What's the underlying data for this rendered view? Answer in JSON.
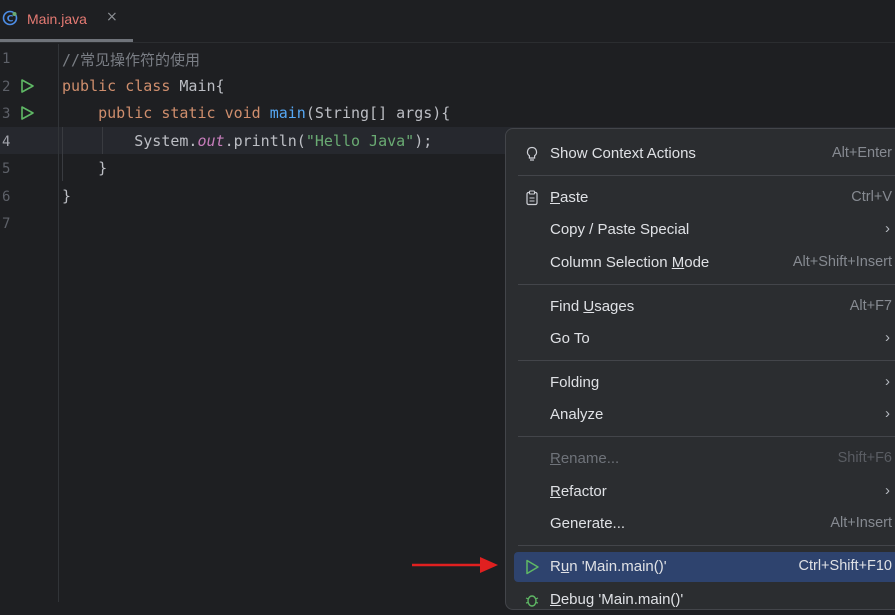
{
  "tab": {
    "filename": "Main.java",
    "close_glyph": "×",
    "icon": "java-class-icon"
  },
  "editor": {
    "line_numbers": [
      "1",
      "2",
      "3",
      "4",
      "5",
      "6",
      "7"
    ],
    "lines": [
      {
        "parts": [
          {
            "t": "//常见操作符的使用",
            "c": "cm"
          }
        ]
      },
      {
        "parts": [
          {
            "t": "public",
            "c": "kw"
          },
          {
            "t": " "
          },
          {
            "t": "class",
            "c": "kw"
          },
          {
            "t": " Main{"
          }
        ]
      },
      {
        "parts": [
          {
            "t": "    "
          },
          {
            "t": "public",
            "c": "kw"
          },
          {
            "t": " "
          },
          {
            "t": "static",
            "c": "kw"
          },
          {
            "t": " "
          },
          {
            "t": "void",
            "c": "kw"
          },
          {
            "t": " "
          },
          {
            "t": "main",
            "c": "fn"
          },
          {
            "t": "(String[] args){"
          }
        ]
      },
      {
        "parts": [
          {
            "t": "        System."
          },
          {
            "t": "out",
            "c": "it"
          },
          {
            "t": ".println("
          },
          {
            "t": "\"Hello Java\"",
            "c": "st"
          },
          {
            "t": ");"
          }
        ]
      },
      {
        "parts": [
          {
            "t": "    }"
          }
        ]
      },
      {
        "parts": [
          {
            "t": "}"
          }
        ]
      },
      {
        "parts": []
      }
    ]
  },
  "menu": {
    "items": [
      {
        "label": "Show Context Actions",
        "shortcut": "Alt+Enter",
        "icon": "lightbulb-icon"
      },
      {
        "label": "Paste",
        "shortcut": "Ctrl+V",
        "icon": "clipboard-icon"
      },
      {
        "label": "Copy / Paste Special",
        "submenu": "›"
      },
      {
        "label": "Column Selection Mode",
        "shortcut": "Alt+Shift+Insert"
      },
      {
        "label": "Find Usages",
        "shortcut": "Alt+F7"
      },
      {
        "label": "Go To",
        "submenu": "›"
      },
      {
        "label": "Folding",
        "submenu": "›"
      },
      {
        "label": "Analyze",
        "submenu": "›"
      },
      {
        "label": "Rename...",
        "shortcut": "Shift+F6",
        "disabled": true
      },
      {
        "label": "Refactor",
        "submenu": "›"
      },
      {
        "label": "Generate...",
        "shortcut": "Alt+Insert"
      },
      {
        "label": "Run 'Main.main()'",
        "shortcut": "Ctrl+Shift+F10",
        "icon": "run-icon",
        "selected": true
      },
      {
        "label": "Debug 'Main.main()'",
        "icon": "debug-icon"
      }
    ]
  },
  "colors": {
    "accent_selected": "#2e436e",
    "annotation_arrow": "#e02020"
  }
}
